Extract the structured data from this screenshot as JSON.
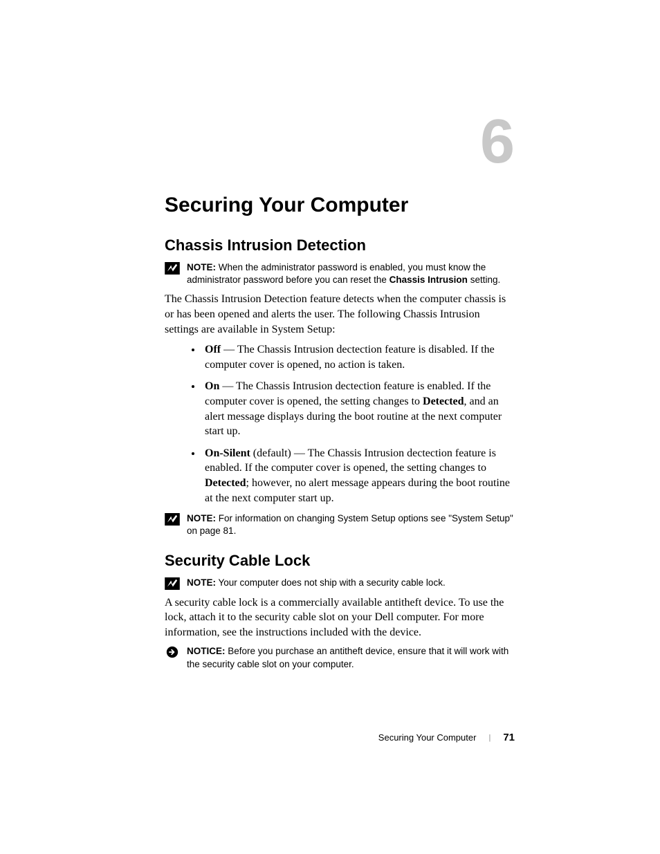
{
  "chapter": {
    "number": "6",
    "title": "Securing Your Computer"
  },
  "section1": {
    "heading": "Chassis Intrusion Detection",
    "note1": {
      "label": "NOTE:",
      "text_a": "When the administrator password is enabled, you must know the administrator password before you can reset the ",
      "bold": "Chassis Intrusion",
      "text_b": " setting."
    },
    "intro": "The Chassis Intrusion Detection feature detects when the computer chassis is or has been opened and alerts the user. The following Chassis Intrusion settings are available in System Setup:",
    "items": [
      {
        "name": "Off",
        "desc": " — The Chassis Intrusion dectection feature is disabled. If the computer cover is opened, no action is taken."
      },
      {
        "name": "On",
        "desc_a": " — The Chassis Intrusion dectection feature is enabled. If the computer cover is opened, the setting changes to ",
        "detected": "Detected",
        "desc_b": ", and an alert message displays during the boot routine at the next computer start up."
      },
      {
        "name": "On-Silent",
        "desc_a": " (default) — The Chassis Intrusion dectection feature is enabled. If the computer cover is opened, the setting changes to ",
        "detected": "Detected",
        "desc_b": "; however, no alert message appears during the boot routine at the next computer start up."
      }
    ],
    "note2": {
      "label": "NOTE:",
      "text": "For information on changing System Setup options see \"System Setup\" on page 81."
    }
  },
  "section2": {
    "heading": "Security Cable Lock",
    "note": {
      "label": "NOTE:",
      "text": "Your computer does not ship with a security cable lock."
    },
    "body": "A security cable lock is a commercially available antitheft device. To use the lock, attach it to the security cable slot on your Dell computer. For more information, see the instructions included with the device.",
    "notice": {
      "label": "NOTICE:",
      "text": "Before you purchase an antitheft device, ensure that it will work with the security cable slot on your computer."
    }
  },
  "footer": {
    "title": "Securing Your Computer",
    "page": "71"
  }
}
